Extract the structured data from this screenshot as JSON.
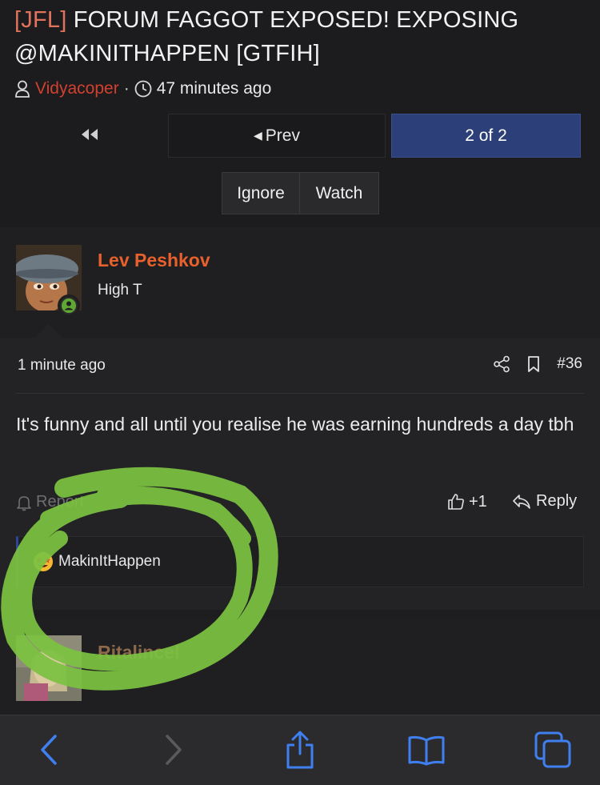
{
  "thread": {
    "prefix": "[JFL]",
    "title": "FORUM FAGGOT EXPOSED! EXPOSING @MAKINITHAPPEN [GTFIH]",
    "author": "Vidyacoper",
    "separator": "·",
    "time": "47 minutes ago"
  },
  "pager": {
    "prev_label": "Prev",
    "current_label": "2 of 2"
  },
  "thread_buttons": {
    "ignore": "Ignore",
    "watch": "Watch"
  },
  "post": {
    "username": "Lev Peshkov",
    "user_title": "High T",
    "time": "1 minute ago",
    "number": "#36",
    "body": "It's funny and all until you realise he was earning hundreds a day tbh",
    "report_label": "Report",
    "like_count": "+1",
    "reply_label": "Reply",
    "reaction_user": "MakinItHappen"
  },
  "next_post": {
    "username": "Ritalincel"
  },
  "colors": {
    "accent_blue": "#2c3f78",
    "username_orange": "#e8612c",
    "author_red": "#d2402f",
    "scribble_green": "#7cc242",
    "ios_blue": "#3f7ff0"
  }
}
